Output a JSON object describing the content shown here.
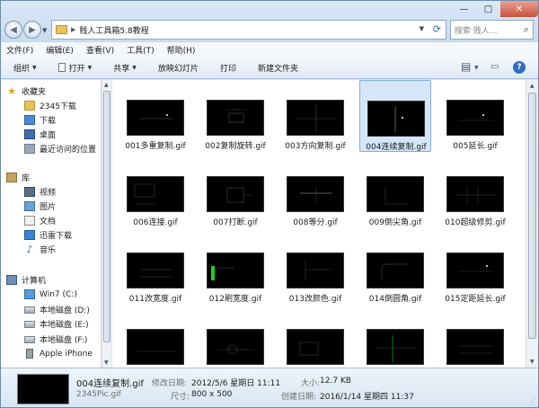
{
  "window": {
    "controls": {
      "minimize": "—",
      "maximize": "□",
      "close": "✕"
    }
  },
  "address": {
    "path": "贱人工具箱5.8教程",
    "search_placeholder": "搜索 贱人..."
  },
  "menu": [
    "文件(F)",
    "编辑(E)",
    "查看(V)",
    "工具(T)",
    "帮助(H)"
  ],
  "toolbar": {
    "organize": "组织",
    "open": "打开",
    "share": "共享",
    "slideshow": "放映幻灯片",
    "print": "打印",
    "new_folder": "新建文件夹"
  },
  "nav": {
    "favorites": "收藏夹",
    "fav_items": [
      "2345下载",
      "下载",
      "桌面",
      "最近访问的位置"
    ],
    "library": "库",
    "lib_items": [
      "视频",
      "图片",
      "文档",
      "迅雷下载",
      "音乐"
    ],
    "computer": "计算机",
    "computer_items": [
      "Win7 (C:)",
      "本地磁盘 (D:)",
      "本地磁盘 (E:)",
      "本地磁盘 (F:)",
      "Apple iPhone"
    ]
  },
  "files": [
    {
      "name": "001多重复制.gif"
    },
    {
      "name": "002复制旋转.gif"
    },
    {
      "name": "003方向复制.gif"
    },
    {
      "name": "004连续复制.gif",
      "selected": true
    },
    {
      "name": "005延长.gif"
    },
    {
      "name": "006连接.gif"
    },
    {
      "name": "007打断.gif"
    },
    {
      "name": "008等分.gif"
    },
    {
      "name": "009倒尖角.gif"
    },
    {
      "name": "010超级修剪.gif"
    },
    {
      "name": "011改宽度.gif"
    },
    {
      "name": "012刷宽度.gif"
    },
    {
      "name": "013改颜色.gif"
    },
    {
      "name": "014倒圆角.gif"
    },
    {
      "name": "015定距延长.gif"
    },
    {
      "name": ""
    },
    {
      "name": ""
    },
    {
      "name": ""
    },
    {
      "name": ""
    },
    {
      "name": ""
    }
  ],
  "details": {
    "name": "004连续复制.gif",
    "subtitle": "2345Pic.gif",
    "modified_label": "修改日期:",
    "modified": "2012/5/6 星期日 11:11",
    "dimensions_label": "尺寸:",
    "dimensions": "800 x 500",
    "size_label": "大小:",
    "size": "12.7 KB",
    "created_label": "创建日期:",
    "created": "2016/1/14 星期四 11:37"
  },
  "colors": {
    "selection": "#d5e6f8",
    "thumb_background": "#000000",
    "cad_line": "#3d3d3d",
    "cad_green": "#20d020"
  }
}
